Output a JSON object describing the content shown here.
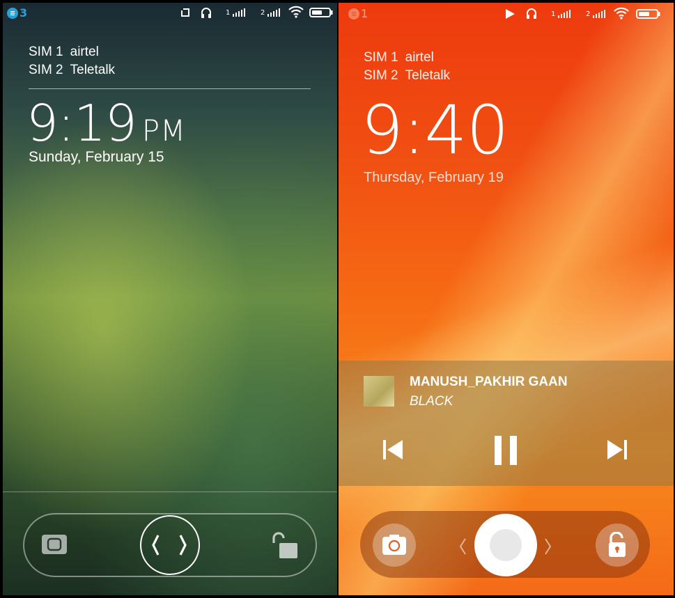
{
  "left_screen": {
    "notification_count": "3",
    "sim1_label": "SIM 1",
    "sim1_carrier": "airtel",
    "sim2_label": "SIM 2",
    "sim2_carrier": "Teletalk",
    "time": "9:19",
    "ampm": "PM",
    "date": "Sunday, February 15",
    "signal1_label": "1",
    "signal2_label": "2",
    "icons": [
      "notification-icon",
      "rotation-lock-icon",
      "headphones-icon",
      "signal-icon",
      "wifi-icon",
      "battery-icon",
      "camera-icon",
      "chevron-left-icon",
      "chevron-right-icon",
      "unlock-icon"
    ],
    "accent_color": "#2aa0d8"
  },
  "right_screen": {
    "notification_count": "1",
    "sim1_label": "SIM 1",
    "sim1_carrier": "airtel",
    "sim2_label": "SIM 2",
    "sim2_carrier": "Teletalk",
    "time": "9:40",
    "date": "Thursday, February 19",
    "signal1_label": "1",
    "signal2_label": "2",
    "track_title": "MANUSH_PAKHIR GAAN",
    "track_artist": "BLACK",
    "icons": [
      "notification-icon",
      "play-status-icon",
      "headphones-icon",
      "signal-icon",
      "wifi-icon",
      "battery-icon",
      "previous-track-icon",
      "pause-icon",
      "next-track-icon",
      "camera-icon",
      "chevron-left-icon",
      "chevron-right-icon",
      "unlock-icon"
    ],
    "background_color": "#f25a14"
  }
}
